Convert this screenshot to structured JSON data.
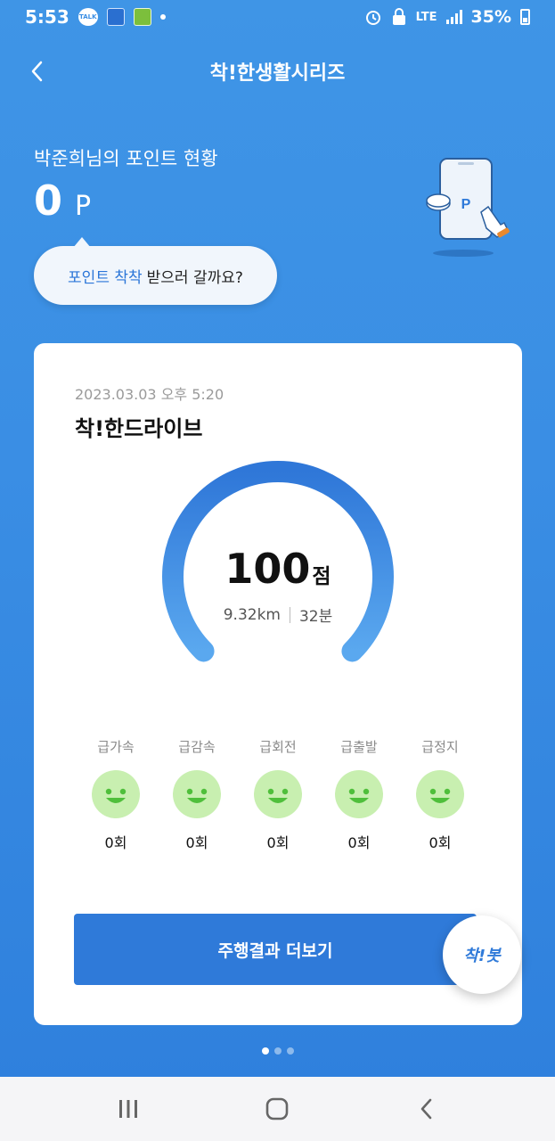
{
  "status_bar": {
    "time": "5:53",
    "talk_badge": "TALK",
    "network": "LTE",
    "battery": "35%"
  },
  "header": {
    "title": "착!한생활시리즈",
    "back_icon": "chevron-left-icon"
  },
  "points": {
    "label": "박준희님의 포인트 현황",
    "value": "0",
    "unit": "P",
    "illustration_icon": "phone-point-icon",
    "illustration_letter": "P"
  },
  "bubble": {
    "accent": "포인트 착착",
    "rest": "받으러 갈까요?"
  },
  "card": {
    "date": "2023.03.03 오후 5:20",
    "title": "착!한드라이브",
    "score": "100",
    "score_unit": "점",
    "gauge_level": 1.0,
    "distance": "9.32km",
    "duration": "32분",
    "events": [
      {
        "label": "급가속",
        "count": "0회",
        "icon": "smile-icon"
      },
      {
        "label": "급감속",
        "count": "0회",
        "icon": "smile-icon"
      },
      {
        "label": "급회전",
        "count": "0회",
        "icon": "smile-icon"
      },
      {
        "label": "급출발",
        "count": "0회",
        "icon": "smile-icon"
      },
      {
        "label": "급정지",
        "count": "0회",
        "icon": "smile-icon"
      }
    ],
    "more_button": "주행결과 더보기",
    "bot_button": "착!봇"
  },
  "pager": {
    "total": 3,
    "active": 1
  },
  "colors": {
    "primary": "#2f7ad9",
    "background": "#3a8ee4",
    "smile": "#c8efb0",
    "smile_face": "#4fbf3b"
  }
}
